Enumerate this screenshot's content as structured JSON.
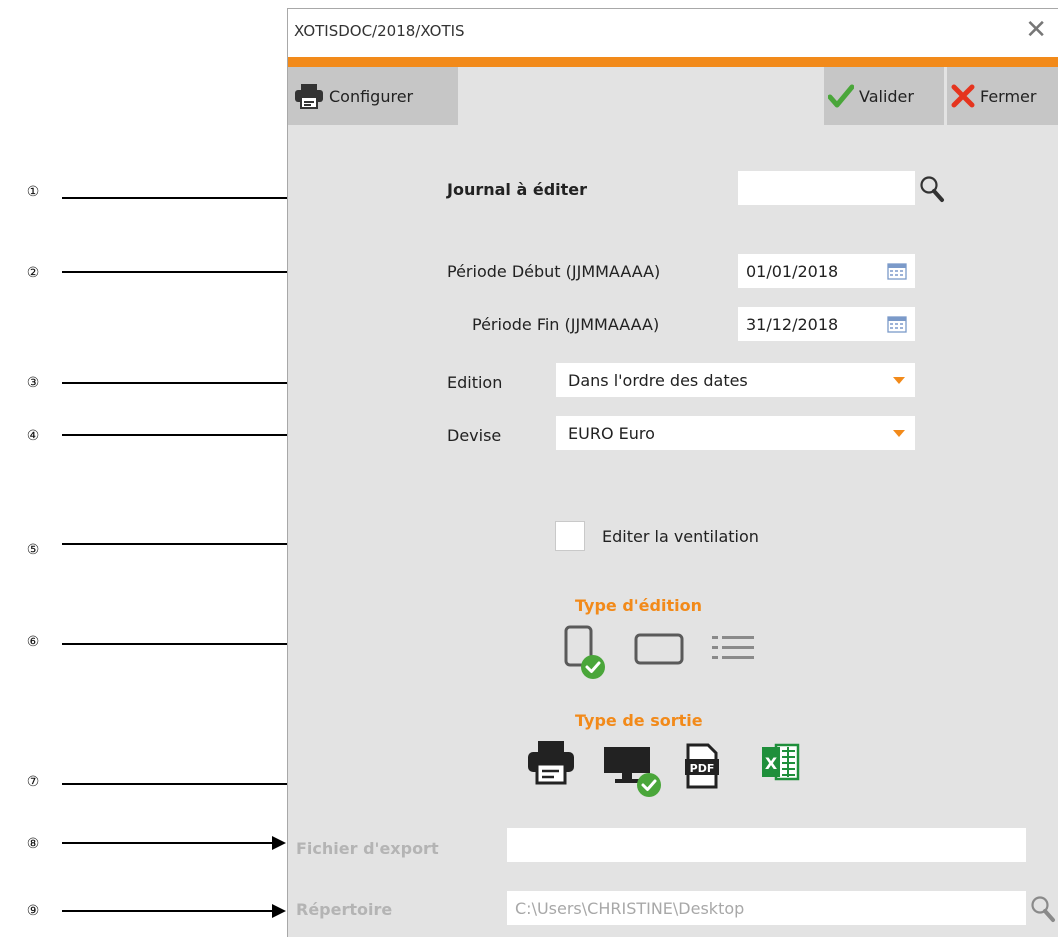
{
  "annotations": [
    "①",
    "②",
    "③",
    "④",
    "⑤",
    "⑥",
    "⑦",
    "⑧",
    "⑨"
  ],
  "window": {
    "title": "XOTISDOC/2018/XOTIS",
    "accent_color": "#f28a1a"
  },
  "toolbar": {
    "configure_label": "Configurer",
    "validate_label": "Valider",
    "close_label": "Fermer"
  },
  "form": {
    "journal_label": "Journal à éditer",
    "journal_value": "",
    "period_start_label": "Période Début (JJMMAAAA)",
    "period_start_value": "01/01/2018",
    "period_end_label": "Période Fin (JJMMAAAA)",
    "period_end_value": "31/12/2018",
    "edition_label": "Edition",
    "edition_value": "Dans l'ordre des dates",
    "currency_label": "Devise",
    "currency_value": "EURO Euro",
    "ventilation_label": "Editer la ventilation",
    "ventilation_checked": false
  },
  "edition_type": {
    "title": "Type d'édition",
    "options": [
      "portrait-page-icon",
      "landscape-page-icon",
      "list-icon"
    ],
    "selected": "portrait-page-icon"
  },
  "output_type": {
    "title": "Type de sortie",
    "options": [
      "printer-icon",
      "screen-icon",
      "pdf-icon",
      "excel-icon"
    ],
    "selected": "screen-icon"
  },
  "export": {
    "file_label": "Fichier d'export",
    "file_value": "",
    "folder_label": "Répertoire",
    "folder_value": "C:\\Users\\CHRISTINE\\Desktop"
  }
}
